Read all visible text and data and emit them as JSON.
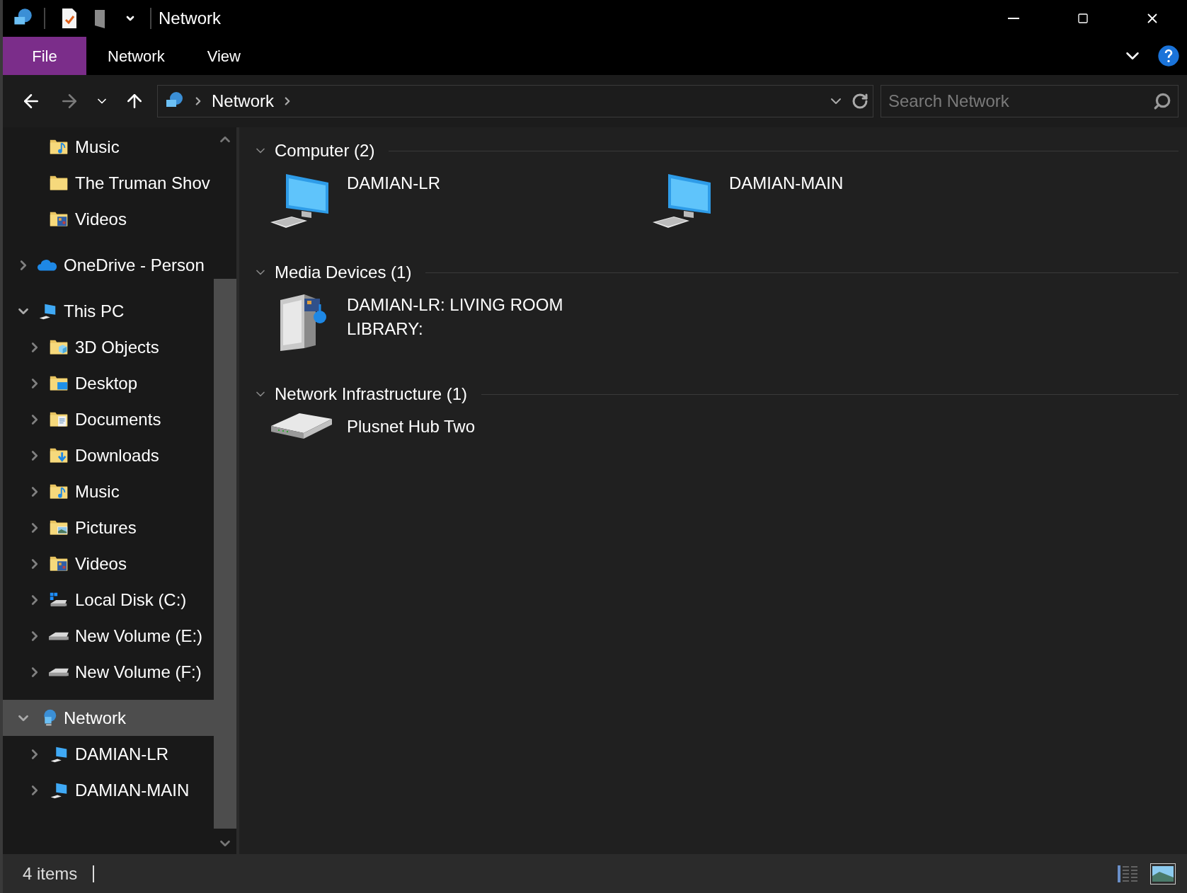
{
  "window": {
    "title": "Network"
  },
  "ribbon": {
    "tabs": [
      {
        "label": "File",
        "kind": "file",
        "selected": false
      },
      {
        "label": "Network",
        "kind": "tab",
        "selected": false
      },
      {
        "label": "View",
        "kind": "tab",
        "selected": false
      }
    ]
  },
  "nav_buttons": [
    {
      "kind": "back",
      "disabled": false
    },
    {
      "kind": "forward",
      "disabled": true
    },
    {
      "kind": "recent",
      "disabled": false
    },
    {
      "kind": "up",
      "disabled": false
    }
  ],
  "address": {
    "crumbs": [
      "Network"
    ]
  },
  "search": {
    "placeholder": "Search Network"
  },
  "sidebar": {
    "scrolled_items": [
      {
        "label": "Music",
        "kind": "music",
        "selected": false
      },
      {
        "label": "The Truman Shov",
        "kind": "folder",
        "selected": false
      },
      {
        "label": "Videos",
        "kind": "video",
        "selected": false
      }
    ],
    "items": [
      {
        "label": "OneDrive - Person",
        "kind": "cloud",
        "expanded": false,
        "selected": false
      },
      {
        "label": "This PC",
        "kind": "pc",
        "expanded": true,
        "selected": false,
        "children": [
          {
            "label": "3D Objects",
            "kind": "objects",
            "expanded": false,
            "selected": false
          },
          {
            "label": "Desktop",
            "kind": "desktop",
            "expanded": false,
            "selected": false
          },
          {
            "label": "Documents",
            "kind": "documents",
            "expanded": false,
            "selected": false
          },
          {
            "label": "Downloads",
            "kind": "downloads",
            "expanded": false,
            "selected": false
          },
          {
            "label": "Music",
            "kind": "music",
            "expanded": false,
            "selected": false
          },
          {
            "label": "Pictures",
            "kind": "pictures",
            "expanded": false,
            "selected": false
          },
          {
            "label": "Videos",
            "kind": "video",
            "expanded": false,
            "selected": false
          },
          {
            "label": "Local Disk (C:)",
            "kind": "systemdrive",
            "expanded": false,
            "selected": false
          },
          {
            "label": "New Volume (E:)",
            "kind": "drive",
            "expanded": false,
            "selected": false
          },
          {
            "label": "New Volume (F:)",
            "kind": "drive",
            "expanded": false,
            "selected": false
          }
        ]
      },
      {
        "label": "Network",
        "kind": "network",
        "expanded": true,
        "selected": true,
        "children": [
          {
            "label": "DAMIAN-LR",
            "kind": "computer",
            "expanded": false,
            "selected": false
          },
          {
            "label": "DAMIAN-MAIN",
            "kind": "computer",
            "expanded": false,
            "selected": false
          }
        ]
      }
    ]
  },
  "groups": [
    {
      "title": "Computer (2)",
      "expanded": true,
      "items": [
        {
          "name": "DAMIAN-LR",
          "kind": "computer"
        },
        {
          "name": "DAMIAN-MAIN",
          "kind": "computer"
        }
      ]
    },
    {
      "title": "Media Devices (1)",
      "expanded": true,
      "items": [
        {
          "name": "DAMIAN-LR: LIVING ROOM LIBRARY:",
          "kind": "media"
        }
      ]
    },
    {
      "title": "Network Infrastructure (1)",
      "expanded": true,
      "items": [
        {
          "name": "Plusnet Hub Two",
          "kind": "router"
        }
      ]
    }
  ],
  "status_bar": {
    "count": "4 items",
    "views": [
      {
        "kind": "details",
        "selected": false
      },
      {
        "kind": "tiles",
        "selected": true
      }
    ]
  }
}
